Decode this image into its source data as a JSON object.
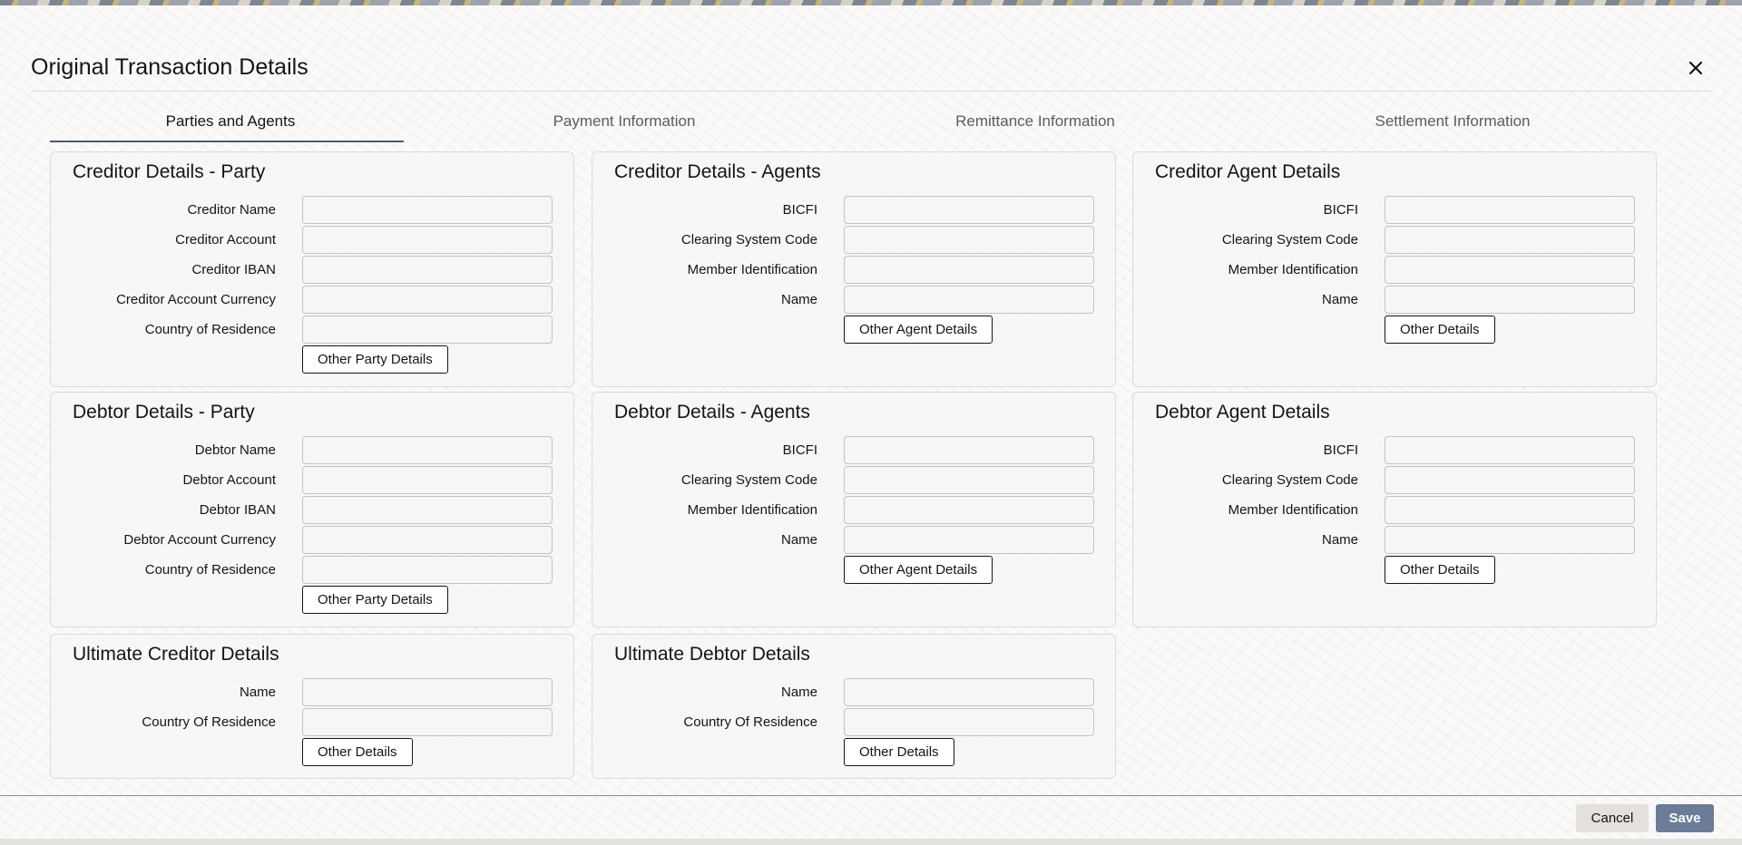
{
  "dialog": {
    "title": "Original Transaction Details"
  },
  "tabs": [
    {
      "label": "Parties and Agents",
      "active": true
    },
    {
      "label": "Payment Information",
      "active": false
    },
    {
      "label": "Remittance Information",
      "active": false
    },
    {
      "label": "Settlement Information",
      "active": false
    }
  ],
  "panels": {
    "creditor_party": {
      "title": "Creditor Details - Party",
      "fields": [
        {
          "label": "Creditor Name",
          "value": ""
        },
        {
          "label": "Creditor Account",
          "value": ""
        },
        {
          "label": "Creditor IBAN",
          "value": ""
        },
        {
          "label": "Creditor Account Currency",
          "value": ""
        },
        {
          "label": "Country of Residence",
          "value": ""
        }
      ],
      "button": "Other Party Details"
    },
    "creditor_agents": {
      "title": "Creditor Details - Agents",
      "fields": [
        {
          "label": "BICFI",
          "value": ""
        },
        {
          "label": "Clearing System Code",
          "value": ""
        },
        {
          "label": "Member Identification",
          "value": ""
        },
        {
          "label": "Name",
          "value": ""
        }
      ],
      "button": "Other Agent Details"
    },
    "creditor_agent": {
      "title": "Creditor Agent Details",
      "fields": [
        {
          "label": "BICFI",
          "value": ""
        },
        {
          "label": "Clearing System Code",
          "value": ""
        },
        {
          "label": "Member Identification",
          "value": ""
        },
        {
          "label": "Name",
          "value": ""
        }
      ],
      "button": "Other Details"
    },
    "debtor_party": {
      "title": "Debtor Details - Party",
      "fields": [
        {
          "label": "Debtor Name",
          "value": ""
        },
        {
          "label": "Debtor Account",
          "value": ""
        },
        {
          "label": "Debtor IBAN",
          "value": ""
        },
        {
          "label": "Debtor Account Currency",
          "value": ""
        },
        {
          "label": "Country of Residence",
          "value": ""
        }
      ],
      "button": "Other Party Details"
    },
    "debtor_agents": {
      "title": "Debtor Details - Agents",
      "fields": [
        {
          "label": "BICFI",
          "value": ""
        },
        {
          "label": "Clearing System Code",
          "value": ""
        },
        {
          "label": "Member Identification",
          "value": ""
        },
        {
          "label": "Name",
          "value": ""
        }
      ],
      "button": "Other Agent Details"
    },
    "debtor_agent": {
      "title": "Debtor Agent Details",
      "fields": [
        {
          "label": "BICFI",
          "value": ""
        },
        {
          "label": "Clearing System Code",
          "value": ""
        },
        {
          "label": "Member Identification",
          "value": ""
        },
        {
          "label": "Name",
          "value": ""
        }
      ],
      "button": "Other Details"
    },
    "ultimate_creditor": {
      "title": "Ultimate Creditor Details",
      "fields": [
        {
          "label": "Name",
          "value": ""
        },
        {
          "label": "Country Of Residence",
          "value": ""
        }
      ],
      "button": "Other Details"
    },
    "ultimate_debtor": {
      "title": "Ultimate Debtor Details",
      "fields": [
        {
          "label": "Name",
          "value": ""
        },
        {
          "label": "Country Of Residence",
          "value": ""
        }
      ],
      "button": "Other Details"
    }
  },
  "footer": {
    "cancel": "Cancel",
    "save": "Save"
  },
  "icons": {
    "close": "close-icon"
  },
  "colors": {
    "accent": "#6a7c97",
    "tab_underline": "#4a5a6a"
  }
}
